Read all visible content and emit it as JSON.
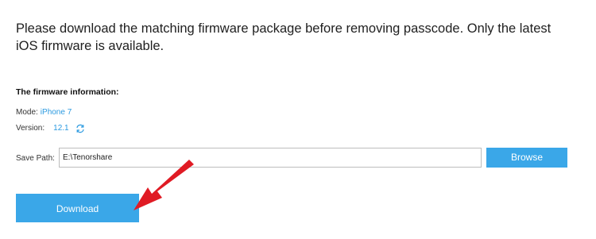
{
  "intro": {
    "line1": "Please download the matching firmware package before removing passcode. Only the latest",
    "line2": "iOS firmware is available."
  },
  "firmware": {
    "title": "The firmware information:",
    "mode_label": "Mode:",
    "mode_value": "iPhone 7",
    "version_label": "Version:",
    "version_value": "12.1"
  },
  "save": {
    "label": "Save Path:",
    "path_value": "E:\\Tenorshare",
    "browse_label": "Browse"
  },
  "download": {
    "label": "Download"
  },
  "colors": {
    "accent": "#3aa7e8",
    "link": "#2b9ae0",
    "arrow": "#e01b24"
  },
  "icons": {
    "refresh": "refresh-icon",
    "pointer": "red-arrow-annotation"
  }
}
